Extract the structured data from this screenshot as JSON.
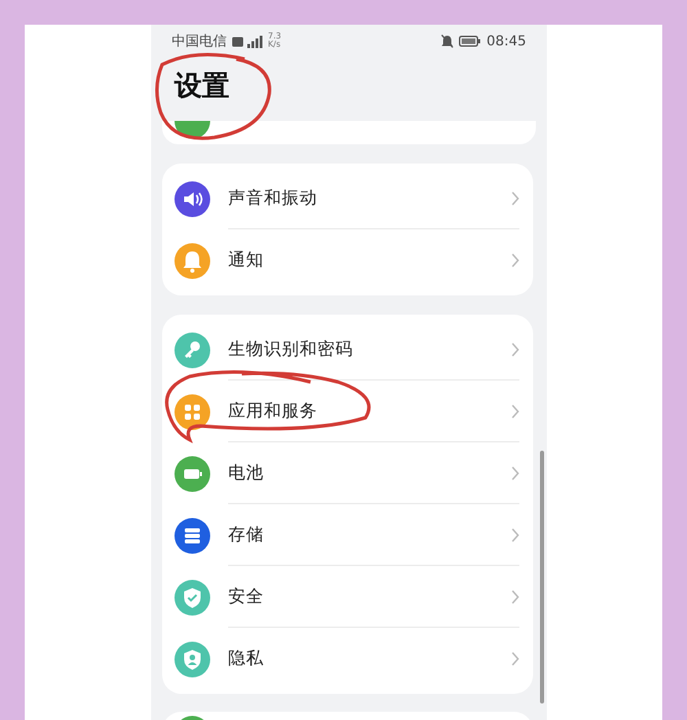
{
  "status_bar": {
    "carrier": "中国电信",
    "speed": "7.3",
    "speed_unit": "K/s",
    "time": "08:45"
  },
  "title": "设置",
  "partial_item": {
    "color": "#4caf50"
  },
  "groups": [
    {
      "items": [
        {
          "label": "声音和振动",
          "kind": "sound",
          "color": "#5a4de0"
        },
        {
          "label": "通知",
          "kind": "bell",
          "color": "#f5a325"
        }
      ]
    },
    {
      "items": [
        {
          "label": "生物识别和密码",
          "kind": "key",
          "color": "#4ec4ab"
        },
        {
          "label": "应用和服务",
          "kind": "apps",
          "color": "#f5a325"
        },
        {
          "label": "电池",
          "kind": "battery",
          "color": "#4caf50"
        },
        {
          "label": "存储",
          "kind": "storage",
          "color": "#1f5fe0"
        },
        {
          "label": "安全",
          "kind": "shield",
          "color": "#4ec4ab"
        },
        {
          "label": "隐私",
          "kind": "privacy",
          "color": "#4ec4ab"
        }
      ]
    }
  ],
  "next_item": {
    "color": "#4caf50"
  }
}
